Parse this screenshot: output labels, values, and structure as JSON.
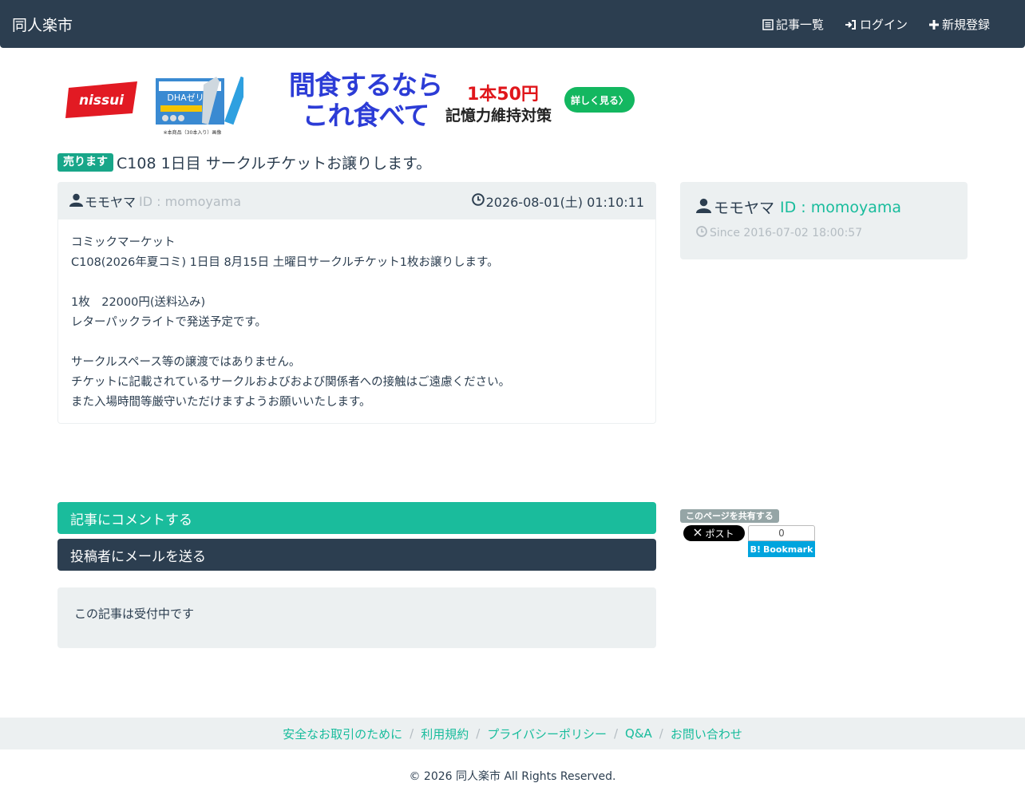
{
  "nav": {
    "brand": "同人楽市",
    "links": [
      {
        "label": "記事一覧",
        "icon": "list-icon"
      },
      {
        "label": "ログイン",
        "icon": "login-icon"
      },
      {
        "label": "新規登録",
        "icon": "plus-icon"
      }
    ]
  },
  "ad": {
    "logo_text": "nissui",
    "product_text": "DHAゼリー",
    "product_note": "※本商品（30本入り）画像",
    "copy_line1": "間食するなら",
    "copy_line2": "これ食べて",
    "price": "1本50円",
    "tagline": "記憶力維持対策",
    "cta": "詳しく見る〉"
  },
  "post": {
    "badge": "売ります",
    "title": "C108 1日目 サークルチケットお譲りします。",
    "author_name": "モモヤマ",
    "author_id": "ID : momoyama",
    "posted_at": "2026-08-01(土) 01:10:11",
    "body": {
      "p1": "コミックマーケット",
      "p2": "C108(2026年夏コミ) 1日目 8月15日 土曜日サークルチケット1枚お譲りします。",
      "p3": "1枚　22000円(送料込み)",
      "p4": "レターパックライトで発送予定です。",
      "p5": "サークルスペース等の譲渡ではありません。",
      "p6": "チケットに記載されているサークルおよびおよび関係者への接触はご遠慮ください。",
      "p7": "また入場時間等厳守いただけますようお願いいたします。"
    }
  },
  "profile": {
    "name": "モモヤマ",
    "id": "ID : momoyama",
    "since": "Since 2016-07-02 18:00:57"
  },
  "actions": {
    "comment": "記事にコメントする",
    "mail": "投稿者にメールを送る"
  },
  "status": "この記事は受付中です",
  "share": {
    "label": "このページを共有する",
    "x_post": "ポスト",
    "hatena_count": "0",
    "hatena_label": "Bookmark"
  },
  "footer": {
    "links": [
      "安全なお取引のために",
      "利用規約",
      "プライバシーポリシー",
      "Q&A",
      "お問い合わせ"
    ],
    "copyright": "© 2026 同人楽市 All Rights Reserved."
  },
  "colors": {
    "navbar": "#2c3e50",
    "accent": "#18bc9c",
    "panel_bg": "#ecf0f1"
  }
}
